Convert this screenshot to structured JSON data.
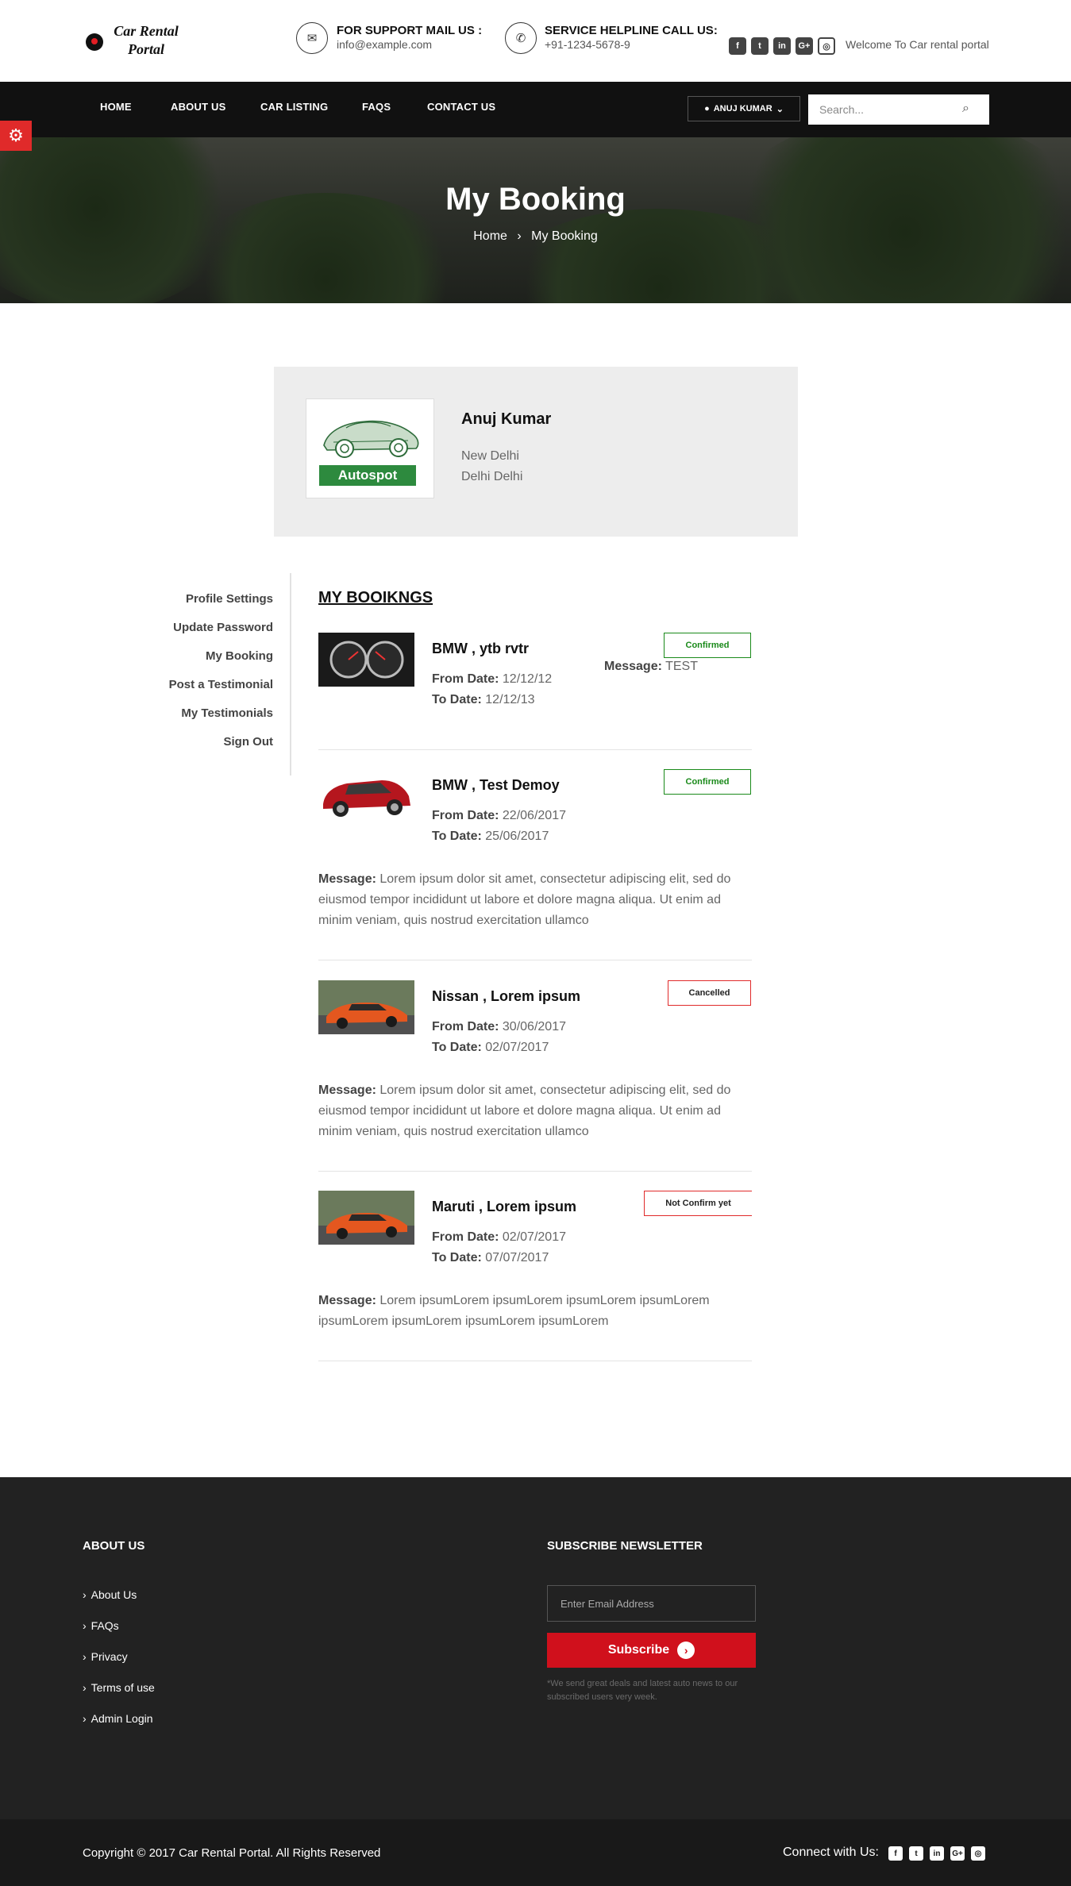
{
  "header": {
    "logo_line1": "Car Rental",
    "logo_line2": "Portal",
    "support_title": "FOR SUPPORT MAIL US :",
    "support_email": "info@example.com",
    "helpline_title": "SERVICE HELPLINE CALL US:",
    "helpline_phone": "+91-1234-5678-9",
    "social": [
      "facebook",
      "twitter",
      "linkedin",
      "google-plus",
      "instagram"
    ],
    "welcome": "Welcome To Car rental portal"
  },
  "nav": {
    "items": [
      "HOME",
      "ABOUT US",
      "CAR LISTING",
      "FAQS",
      "CONTACT US"
    ],
    "user_label": "ANUJ KUMAR",
    "search_placeholder": "Search..."
  },
  "banner": {
    "title": "My Booking",
    "crumb_home": "Home",
    "crumb_current": "My Booking"
  },
  "profile": {
    "image_label": "Autospot",
    "name": "Anuj Kumar",
    "city": "New Delhi",
    "state": "Delhi Delhi"
  },
  "sidebar": {
    "items": [
      "Profile Settings",
      "Update Password",
      "My Booking",
      "Post a Testimonial",
      "My Testimonials",
      "Sign Out"
    ]
  },
  "bookings_heading": "MY BOOIKNGS",
  "labels": {
    "from": "From Date:",
    "to": "To Date:",
    "message": "Message:"
  },
  "bookings": [
    {
      "title": "BMW , ytb rvtr",
      "from": "12/12/12",
      "to": "12/12/13",
      "status": "Confirmed",
      "message": "TEST"
    },
    {
      "title": "BMW , Test Demoy",
      "from": "22/06/2017",
      "to": "25/06/2017",
      "status": "Confirmed",
      "message": "Lorem ipsum dolor sit amet, consectetur adipiscing elit, sed do eiusmod tempor incididunt ut labore et dolore magna aliqua. Ut enim ad minim veniam, quis nostrud exercitation ullamco"
    },
    {
      "title": "Nissan , Lorem ipsum",
      "from": "30/06/2017",
      "to": "02/07/2017",
      "status": "Cancelled",
      "message": "Lorem ipsum dolor sit amet, consectetur adipiscing elit, sed do eiusmod tempor incididunt ut labore et dolore magna aliqua. Ut enim ad minim veniam, quis nostrud exercitation ullamco"
    },
    {
      "title": "Maruti , Lorem ipsum",
      "from": "02/07/2017",
      "to": "07/07/2017",
      "status": "Not Confirm yet",
      "message": "Lorem ipsumLorem ipsumLorem ipsumLorem ipsumLorem ipsumLorem ipsumLorem ipsumLorem ipsumLorem"
    }
  ],
  "footer": {
    "about_title": "ABOUT US",
    "links": [
      "About Us",
      "FAQs",
      "Privacy",
      "Terms of use",
      "Admin Login"
    ],
    "newsletter_title": "SUBSCRIBE NEWSLETTER",
    "email_placeholder": "Enter Email Address",
    "subscribe_label": "Subscribe",
    "note": "*We send great deals and latest auto news to our subscribed users very week.",
    "copyright": "Copyright © 2017 Car Rental Portal. All Rights Reserved",
    "connect": "Connect with Us:"
  },
  "colors": {
    "brand_red": "#d0101c",
    "confirmed": "#1a8a1a",
    "navbar": "#111111",
    "footer": "#222222"
  }
}
